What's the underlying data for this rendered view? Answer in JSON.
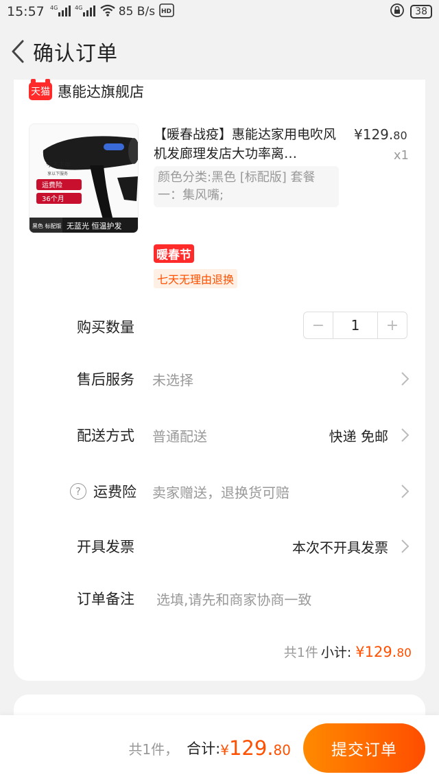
{
  "status_bar": {
    "time": "15:57",
    "network1": "4G",
    "network2": "4G",
    "speed": "85 B/s",
    "battery": "38"
  },
  "header": {
    "title": "确认订单"
  },
  "shop": {
    "badge": "天猫",
    "name": "惠能达旗舰店"
  },
  "product": {
    "title": "【暖春战疫】惠能达家用电吹风机发廊理发店大功率离…",
    "price_main": "¥129.",
    "price_cents": "80",
    "qty": "x1",
    "spec": "颜色分类:黑色 [标配版] 套餐一：集风嘴;",
    "promo_tag": "暖春节",
    "return_tag": "七天无理由退换",
    "image": {
      "promo_line1": "今天下单",
      "promo_line2": "享以下服务",
      "promo_badge1": "运费险",
      "promo_badge2": "36个月",
      "variant": "黑色 标配版",
      "features": "无蓝光 恒温护发"
    }
  },
  "rows": {
    "quantity": {
      "label": "购买数量",
      "value": "1",
      "minus": "−",
      "plus": "+"
    },
    "after_sales": {
      "label": "售后服务",
      "value": "未选择"
    },
    "delivery": {
      "label": "配送方式",
      "value": "普通配送",
      "right": "快递 免邮"
    },
    "insurance": {
      "label": "运费险",
      "value": "卖家赠送，退换货可赔",
      "help": "?"
    },
    "invoice": {
      "label": "开具发票",
      "right": "本次不开具发票"
    },
    "note": {
      "label": "订单备注",
      "placeholder": "选填,请先和商家协商一致"
    }
  },
  "subtotal": {
    "count": "共1件",
    "label": "小计:",
    "amount_main": "¥129.",
    "amount_cents": "80"
  },
  "bottom_bar": {
    "count": "共1件，",
    "label": "合计:",
    "yen": "¥",
    "amount_main": "129.",
    "amount_cents": "80",
    "submit": "提交订单"
  },
  "colors": {
    "accent": "#ff5000",
    "tmall_red": "#ff2a2a",
    "submit_gradient_start": "#ff8a00",
    "submit_gradient_end": "#ff4d00"
  }
}
